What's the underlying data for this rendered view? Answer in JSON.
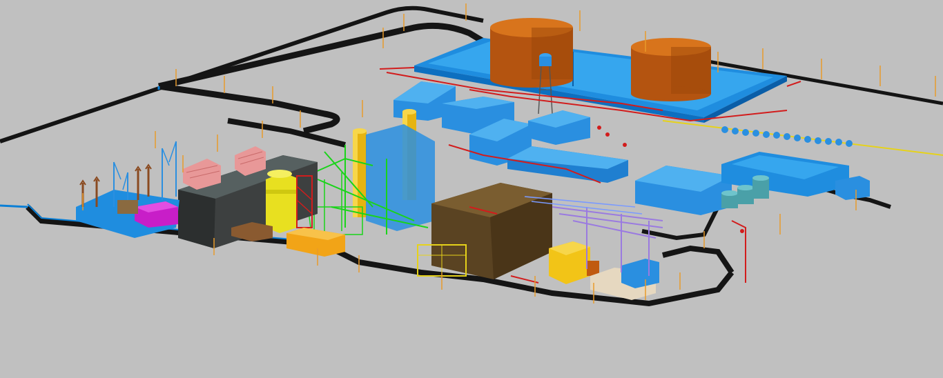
{
  "scene": {
    "background": "#c0c0c0",
    "colors": {
      "road": "#1a1a1a",
      "curb": "#0a7fd6",
      "building_blue": "#2a8fe0",
      "building_blue_light": "#4fb1f0",
      "tank_body": "#c05a10",
      "tank_top": "#d8741c",
      "stack_yellow": "#f2c417",
      "turbine_hall": "#4a4a4a",
      "brown_building": "#7a5a2a",
      "pipe_red": "#d21c1c",
      "pipe_green": "#19d419",
      "pipe_purple": "#9a7ae0",
      "magenta": "#c81ec8",
      "pink": "#e89898",
      "lamp_orange": "#e89a2a"
    },
    "objects": [
      "storage-tank",
      "storage-tank",
      "water-tower",
      "exhaust-stack",
      "exhaust-stack",
      "turbine-hall",
      "transformer-yard",
      "control-building",
      "workshop-building",
      "admin-building",
      "brown-steam-turbine-building",
      "small-water-tanks",
      "cooling-fan-bank"
    ]
  }
}
